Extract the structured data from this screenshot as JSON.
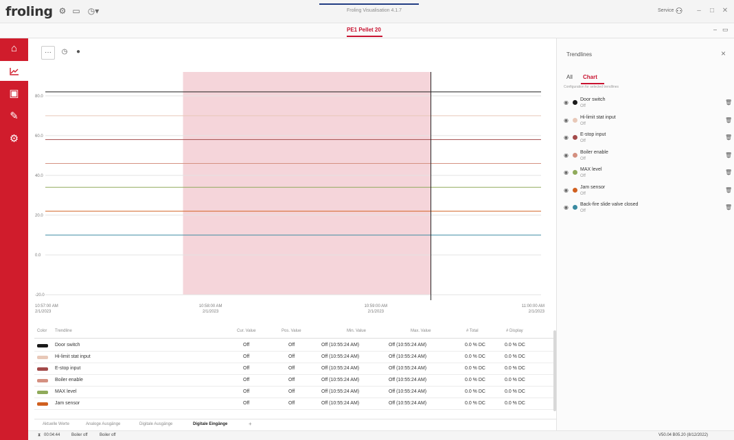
{
  "titlebar": {
    "logo": "froling",
    "app_title": "Froling Visualisation 4.1.7",
    "service_label": "Service",
    "icons": [
      "gear-icon",
      "monitor-icon",
      "clock-icon"
    ]
  },
  "device_tab": {
    "label": "PE1 Pellet 20"
  },
  "sidenav": {
    "items": [
      {
        "icon": "home-icon",
        "glyph": "⌂"
      },
      {
        "icon": "chart-icon",
        "glyph": "📈"
      },
      {
        "icon": "boiler-icon",
        "glyph": "▣"
      },
      {
        "icon": "wrench-icon",
        "glyph": "🔧"
      },
      {
        "icon": "gear-icon",
        "glyph": "⚙"
      }
    ],
    "active_index": 1
  },
  "chart_toolbar": {
    "more_label": "···",
    "history_glyph": "◷",
    "settings_glyph": "●"
  },
  "chart_data": {
    "type": "line",
    "y_ticks": [
      "80.0",
      "60.0",
      "40.0",
      "20.0",
      "0.0",
      "-20.0"
    ],
    "y_tick_values": [
      80,
      60,
      40,
      20,
      0,
      -20
    ],
    "ylim": [
      -20,
      92
    ],
    "x_ticks": [
      {
        "time": "10:57:00 AM",
        "date": "2/1/2023"
      },
      {
        "time": "10:58:00 AM",
        "date": "2/1/2023"
      },
      {
        "time": "10:59:00 AM",
        "date": "2/1/2023"
      },
      {
        "time": "11:00:00 AM",
        "date": "2/1/2023"
      }
    ],
    "xlim": [
      "10:57:00 AM",
      "11:00:00 AM"
    ],
    "highlight_range": [
      "10:57:50 AM",
      "10:59:20 AM"
    ],
    "highlight_color": "#f5d5da",
    "cursor_time": "10:59:20 AM",
    "series": [
      {
        "name": "Door switch",
        "color": "#1a1a1a",
        "value": 82
      },
      {
        "name": "Hi-limit stat input",
        "color": "#e8c8b8",
        "value": 70
      },
      {
        "name": "E-stop input",
        "color": "#a34a4a",
        "value": 58
      },
      {
        "name": "Boiler enable",
        "color": "#d49080",
        "value": 46
      },
      {
        "name": "MAX level",
        "color": "#8faa5a",
        "value": 34
      },
      {
        "name": "Jam sensor",
        "color": "#d06020",
        "value": 22
      },
      {
        "name": "Back-fire slide valve closed",
        "color": "#3a8aa0",
        "value": 10
      }
    ]
  },
  "table": {
    "headers": [
      "Color",
      "Trendline",
      "Cur. Value",
      "Pos. Value",
      "Min. Value",
      "Max. Value",
      "# Total",
      "# Display"
    ],
    "rows": [
      {
        "color": "#1a1a1a",
        "name": "Door switch",
        "cur": "Off",
        "pos": "Off",
        "min": "Off (10:55:24 AM)",
        "max": "Off (10:55:24 AM)",
        "total": "0.0 % DC",
        "display": "0.0 % DC"
      },
      {
        "color": "#e8c8b8",
        "name": "Hi-limit stat input",
        "cur": "Off",
        "pos": "Off",
        "min": "Off (10:55:24 AM)",
        "max": "Off (10:55:24 AM)",
        "total": "0.0 % DC",
        "display": "0.0 % DC"
      },
      {
        "color": "#a34a4a",
        "name": "E-stop input",
        "cur": "Off",
        "pos": "Off",
        "min": "Off (10:55:24 AM)",
        "max": "Off (10:55:24 AM)",
        "total": "0.0 % DC",
        "display": "0.0 % DC"
      },
      {
        "color": "#d49080",
        "name": "Boiler enable",
        "cur": "Off",
        "pos": "Off",
        "min": "Off (10:55:24 AM)",
        "max": "Off (10:55:24 AM)",
        "total": "0.0 % DC",
        "display": "0.0 % DC"
      },
      {
        "color": "#8faa5a",
        "name": "MAX level",
        "cur": "Off",
        "pos": "Off",
        "min": "Off (10:55:24 AM)",
        "max": "Off (10:55:24 AM)",
        "total": "0.0 % DC",
        "display": "0.0 % DC"
      },
      {
        "color": "#d06020",
        "name": "Jam sensor",
        "cur": "Off",
        "pos": "Off",
        "min": "Off (10:55:24 AM)",
        "max": "Off (10:55:24 AM)",
        "total": "0.0 % DC",
        "display": "0.0 % DC"
      }
    ]
  },
  "bottom_tabs": {
    "items": [
      "Aktuelle Werte",
      "Analoge Ausgänge",
      "Digitale Ausgänge",
      "Digitale Eingänge",
      "+"
    ],
    "active_index": 3
  },
  "statusbar": {
    "time": "00:04:44",
    "status1": "Boiler off",
    "status2": "Boiler off",
    "version": "V50.04 B05.20 (8/12/2022)"
  },
  "trendlines_panel": {
    "title": "Trendlines",
    "tabs": [
      "All",
      "Chart"
    ],
    "active_tab": 1,
    "subtitle": "Configuration for selected trendlines",
    "items": [
      {
        "name": "Door switch",
        "state": "Off",
        "color": "#1a1a1a"
      },
      {
        "name": "Hi-limit stat input",
        "state": "Off",
        "color": "#e8c8b8"
      },
      {
        "name": "E-stop input",
        "state": "Off",
        "color": "#a34a4a"
      },
      {
        "name": "Boiler enable",
        "state": "Off",
        "color": "#d49080"
      },
      {
        "name": "MAX level",
        "state": "Off",
        "color": "#8faa5a"
      },
      {
        "name": "Jam sensor",
        "state": "Off",
        "color": "#d06020"
      },
      {
        "name": "Back-fire slide valve closed",
        "state": "Off",
        "color": "#3a8aa0"
      }
    ]
  }
}
